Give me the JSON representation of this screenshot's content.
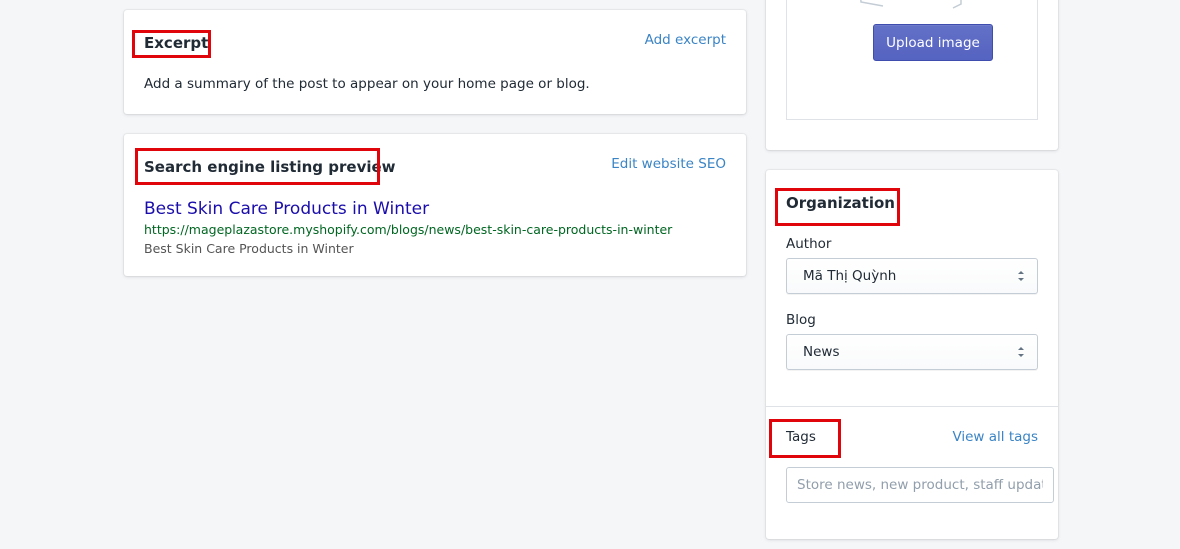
{
  "excerpt": {
    "title": "Excerpt",
    "action": "Add excerpt",
    "description": "Add a summary of the post to appear on your home page or blog."
  },
  "seo": {
    "title": "Search engine listing preview",
    "action": "Edit website SEO",
    "preview_title": "Best Skin Care Products in Winter",
    "preview_url": "https://mageplazastore.myshopify.com/blogs/news/best-skin-care-products-in-winter",
    "preview_description": "Best Skin Care Products in Winter"
  },
  "image": {
    "upload_label": "Upload image"
  },
  "organization": {
    "title": "Organization",
    "author_label": "Author",
    "author_value": "Mã Thị Quỳnh",
    "blog_label": "Blog",
    "blog_value": "News"
  },
  "tags": {
    "title": "Tags",
    "action": "View all tags",
    "placeholder": "Store news, new product, staff update"
  },
  "colors": {
    "highlight": "#e0050a",
    "link": "#3a84c5",
    "primary_button": "#5c6ac4",
    "seo_title": "#1a0dab",
    "seo_url": "#006621"
  }
}
